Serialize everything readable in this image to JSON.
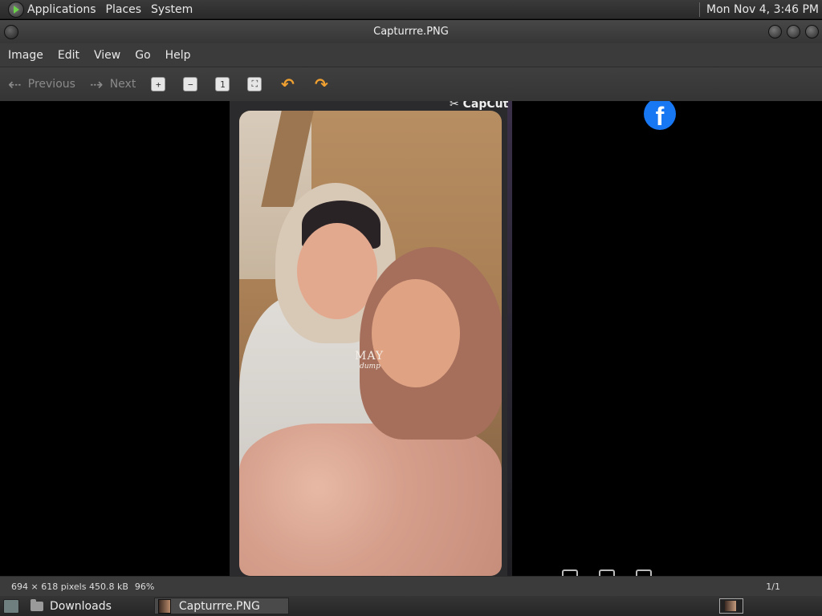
{
  "top_panel": {
    "menus": [
      "Applications",
      "Places",
      "System"
    ],
    "clock": "Mon Nov  4,  3:46 PM"
  },
  "window": {
    "title": "Capturrre.PNG"
  },
  "menubar": {
    "items": [
      "Image",
      "Edit",
      "View",
      "Go",
      "Help"
    ]
  },
  "toolbar": {
    "previous_label": "Previous",
    "next_label": "Next",
    "icons": [
      "zoom-in-icon",
      "zoom-out-icon",
      "normal-size-icon",
      "best-fit-icon",
      "rotate-left-icon",
      "rotate-right-icon"
    ]
  },
  "image": {
    "capcut_label": "CapCut",
    "watermark_main": "MAY",
    "watermark_sub": "dump",
    "fb_glyph": "f"
  },
  "statusbar": {
    "info": "694 × 618 pixels  450.8 kB",
    "zoom": "96%",
    "page": "1/1"
  },
  "taskbar": {
    "tasks": [
      "Downloads",
      "Capturrre.PNG"
    ]
  },
  "colors": {
    "facebook_blue": "#1877f2",
    "rotate_orange": "#f0a030"
  }
}
